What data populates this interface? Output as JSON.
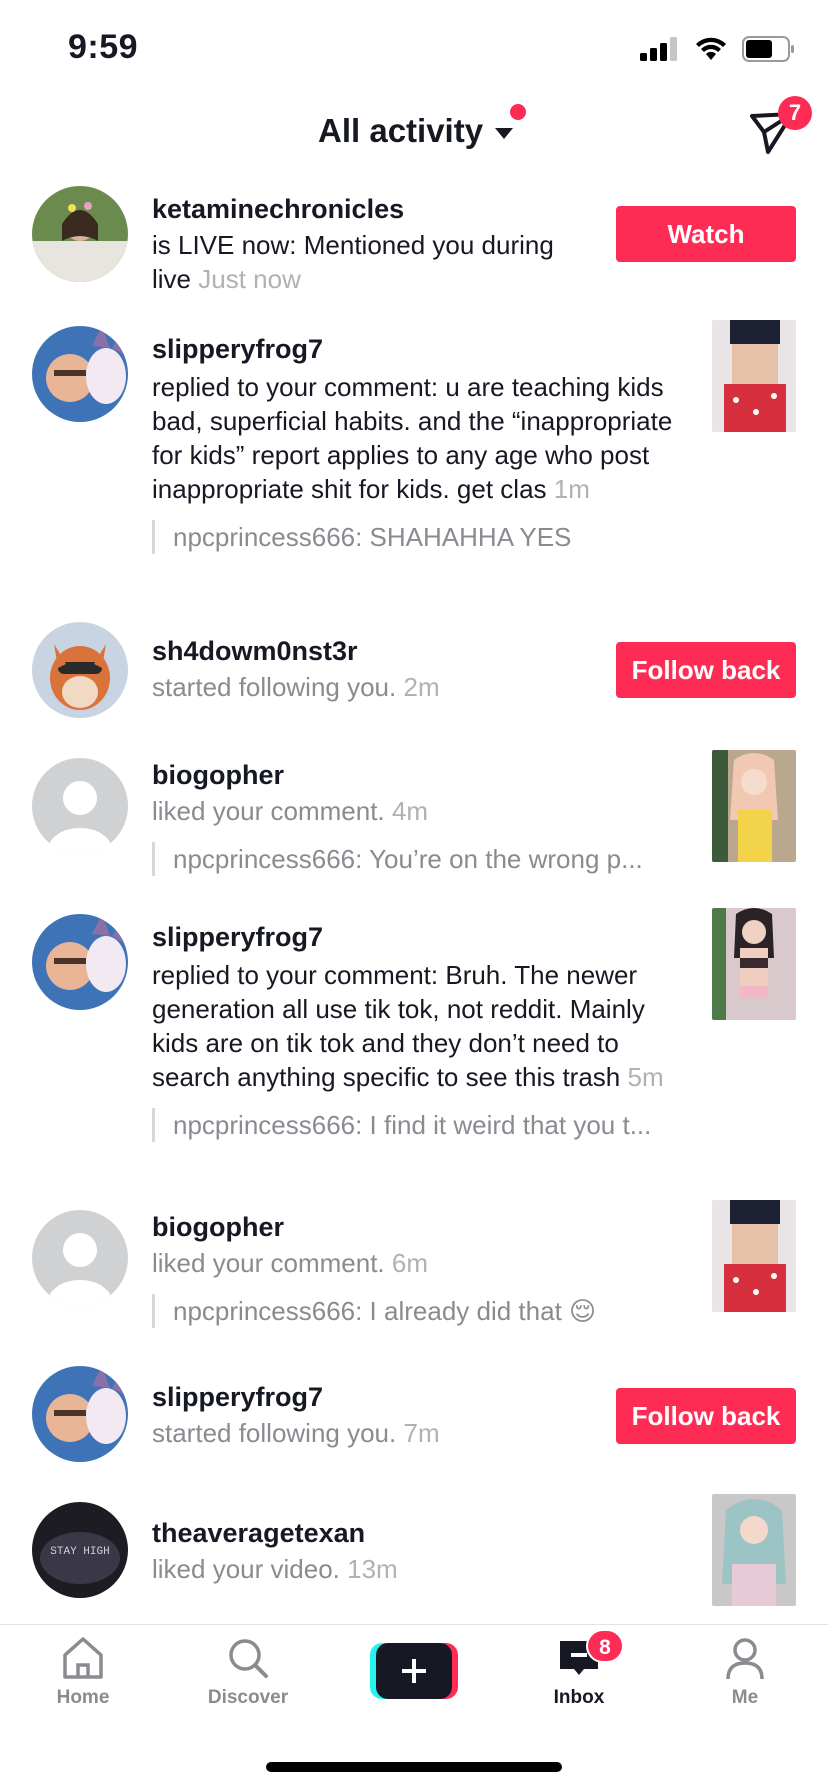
{
  "status_bar": {
    "time": "9:59"
  },
  "header": {
    "title": "All activity",
    "dm_badge": "7"
  },
  "colors": {
    "accent": "#fe2c55",
    "text": "#161823",
    "secondary": "#8a8b91",
    "time": "#b0b1b5"
  },
  "activities": [
    {
      "username": "ketaminechronicles",
      "message": "is LIVE now: Mentioned you during live",
      "time": "Just now",
      "action": "Watch"
    },
    {
      "username": "slipperyfrog7",
      "message": "replied to your comment: u are teaching kids bad, superficial habits. and the “inappropriate for kids” report applies to any age who post inappropriate shit for kids. get clas",
      "time": "1m",
      "quote": "npcprincess666: SHAHAHHA YES"
    },
    {
      "username": "sh4dowm0nst3r",
      "message": "started following you.",
      "time": "2m",
      "action": "Follow back"
    },
    {
      "username": "biogopher",
      "message": "liked your comment.",
      "time": "4m",
      "quote": "npcprincess666: You’re on the wrong p..."
    },
    {
      "username": "slipperyfrog7",
      "message": "replied to your comment: Bruh. The newer generation all use tik tok, not reddit. Mainly kids are on tik tok and they don’t need to search anything specific to see this trash",
      "time": "5m",
      "quote": "npcprincess666: I find it weird that you t..."
    },
    {
      "username": "biogopher",
      "message": "liked your comment.",
      "time": "6m",
      "quote": "npcprincess666: I already did that 😌"
    },
    {
      "username": "slipperyfrog7",
      "message": "started following you.",
      "time": "7m",
      "action": "Follow back"
    },
    {
      "username": "theaveragetexan",
      "message": "liked your video.",
      "time": "13m",
      "avatar_text": "STAY HIGH"
    }
  ],
  "tabs": [
    {
      "label": "Home",
      "icon": "home-icon"
    },
    {
      "label": "Discover",
      "icon": "search-icon"
    },
    {
      "label": "",
      "icon": "plus-icon"
    },
    {
      "label": "Inbox",
      "icon": "inbox-icon",
      "badge": "8"
    },
    {
      "label": "Me",
      "icon": "profile-icon"
    }
  ]
}
